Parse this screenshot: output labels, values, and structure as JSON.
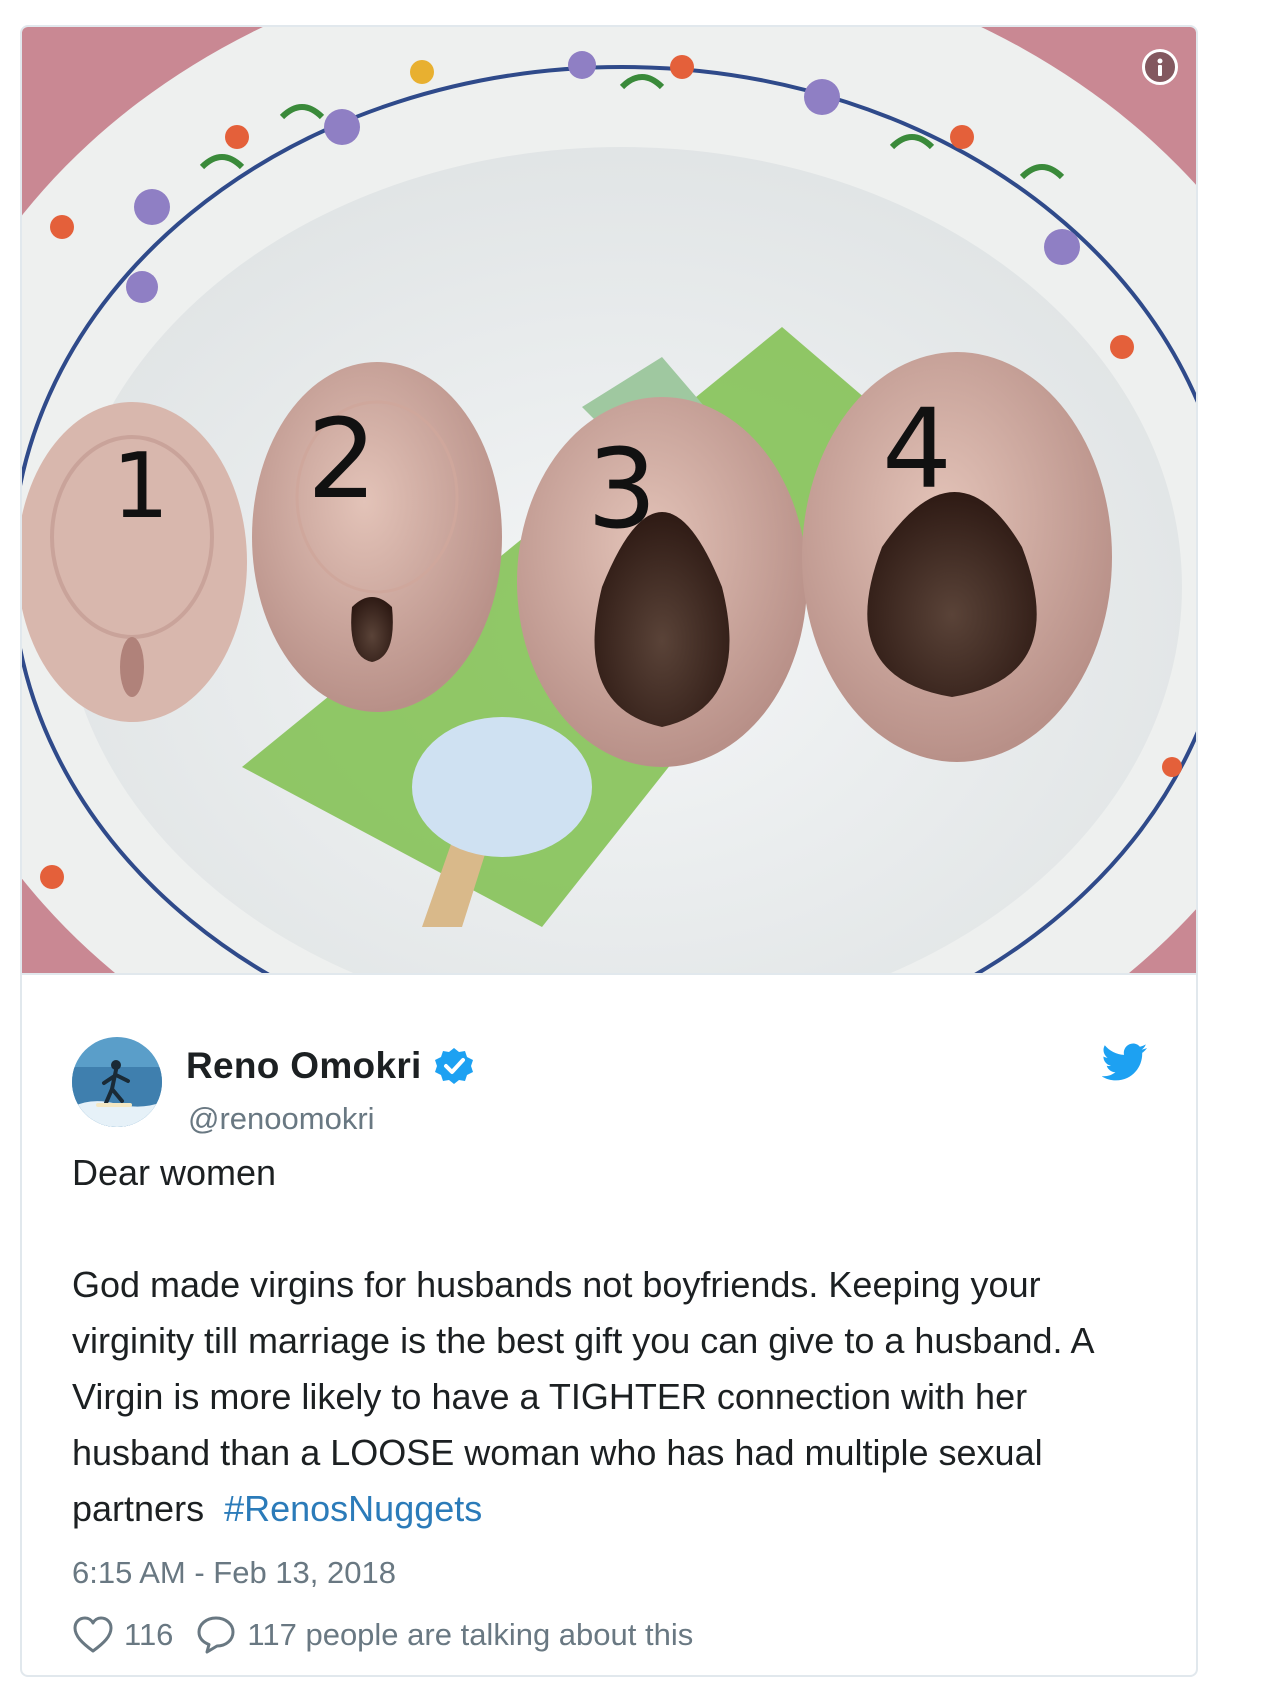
{
  "media": {
    "labels": [
      "1",
      "2",
      "3",
      "4"
    ],
    "info_icon": "info-icon"
  },
  "author": {
    "name": "Reno Omokri",
    "handle": "@renoomokri",
    "verified_icon": "verified-badge-icon",
    "avatar_icon": "surfer-avatar"
  },
  "tweet": {
    "line1": "Dear women",
    "body": "God made virgins for husbands not boyfriends. Keeping your virginity till marriage is the best gift you can give to a husband. A Virgin is more likely to have a TIGHTER connection with her husband than a LOOSE woman who has had multiple sexual partners",
    "hashtag": "#RenosNuggets",
    "timestamp": "6:15 AM - Feb 13, 2018"
  },
  "actions": {
    "likes": "116",
    "talking": "117 people are talking about this"
  },
  "colors": {
    "link": "#2b7bb9",
    "twitter_blue": "#1da1f2",
    "muted": "#697882",
    "border": "#e1e8ed"
  }
}
